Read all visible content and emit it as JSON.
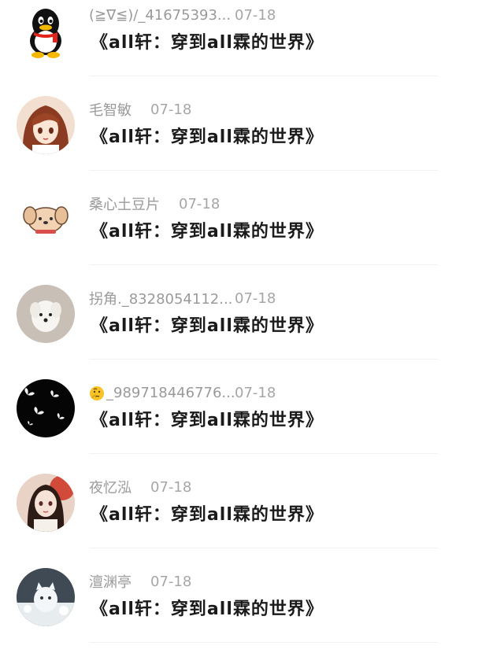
{
  "comments": [
    {
      "username": "(≧∇≦)/_41675393...",
      "date": "07-18",
      "text": "《all轩：穿到all霖的世界》",
      "avatar_icon": "qq-penguin-icon"
    },
    {
      "username": "毛智敏",
      "date": "07-18",
      "text": "《all轩：穿到all霖的世界》",
      "avatar_icon": "anime-girl-avatar"
    },
    {
      "username": "桑心土豆片",
      "date": "07-18",
      "text": "《all轩：穿到all霖的世界》",
      "avatar_icon": "puppy-avatar"
    },
    {
      "username": "拐角._8328054112...",
      "date": "07-18",
      "text": "《all轩：穿到all霖的世界》",
      "avatar_icon": "white-dog-avatar"
    },
    {
      "username": "_989718446776...",
      "date": "07-18",
      "text": "《all轩：穿到all霖的世界》",
      "avatar_icon": "butterfly-avatar",
      "name_prefix_icon": "thinking-emoji-icon"
    },
    {
      "username": "夜忆泓",
      "date": "07-18",
      "text": "《all轩：穿到all霖的世界》",
      "avatar_icon": "ancient-girl-avatar"
    },
    {
      "username": "澶渊亭",
      "date": "07-18",
      "text": "《all轩：穿到all霖的世界》",
      "avatar_icon": "snow-cat-avatar"
    }
  ]
}
